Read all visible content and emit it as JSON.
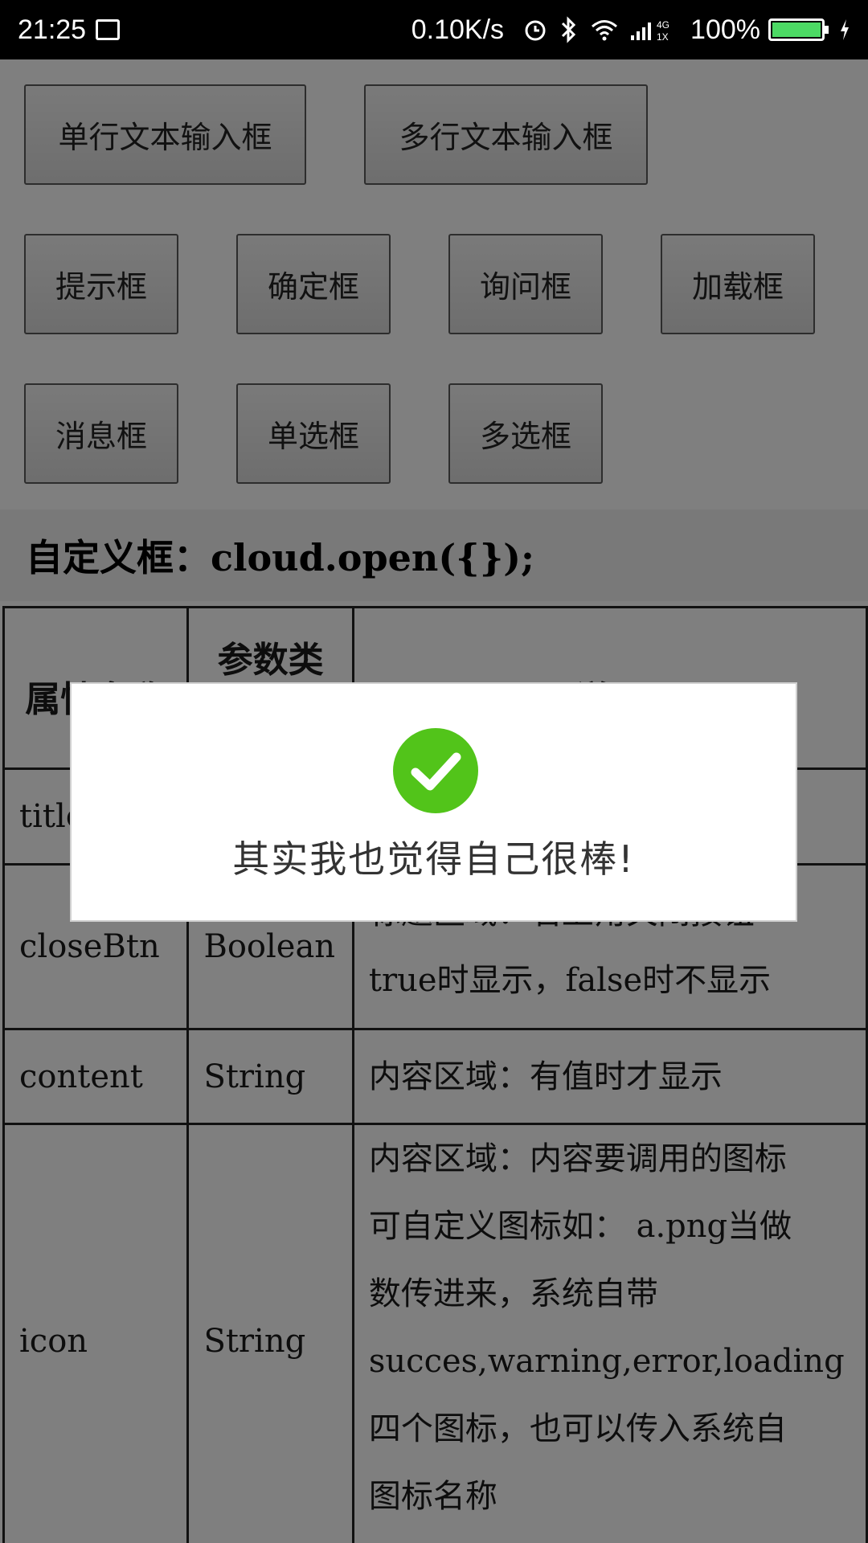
{
  "status_bar": {
    "time": "21:25",
    "net_speed": "0.10K/s",
    "network_label": "4G 1X",
    "battery_percent": "100%",
    "battery_level": 1.0,
    "icons": [
      "screenshot-icon",
      "alarm-icon",
      "bluetooth-icon",
      "wifi-icon",
      "signal-icon",
      "battery-icon",
      "charging-icon"
    ]
  },
  "buttons": {
    "single_line_input": "单行文本输入框",
    "multi_line_input": "多行文本输入框",
    "hint": "提示框",
    "confirm": "确定框",
    "ask": "询问框",
    "loading": "加载框",
    "message": "消息框",
    "single_select": "单选框",
    "multi_select": "多选框"
  },
  "custom_section": {
    "heading": "自定义框：cloud.open({});"
  },
  "table": {
    "headers": {
      "name": "属性名称",
      "type": "参数类",
      "desc": "说明"
    },
    "rows": [
      {
        "name": "title",
        "type": "",
        "desc_lines": [
          "",
          ""
        ]
      },
      {
        "name": "closeBtn",
        "type": "Boolean",
        "desc_lines": [
          "标题区域：右上角关闭按钮",
          "true时显示，false时不显示"
        ]
      },
      {
        "name": "content",
        "type": "String",
        "desc_lines": [
          "内容区域：有值时才显示"
        ]
      },
      {
        "name": "icon",
        "type": "String",
        "desc_lines": [
          "内容区域：内容要调用的图标",
          "可自定义图标如： a.png当做",
          "数传进来，系统自带",
          "succes,warning,error,loading",
          "四个图标，也可以传入系统自",
          "图标名称"
        ]
      }
    ]
  },
  "toast": {
    "icon": "check-circle-icon",
    "icon_color": "#52C41A",
    "message": "其实我也觉得自己很棒!"
  },
  "colors": {
    "overlay": "rgba(0,0,0,0.5)",
    "status_bar_bg": "#000000"
  }
}
